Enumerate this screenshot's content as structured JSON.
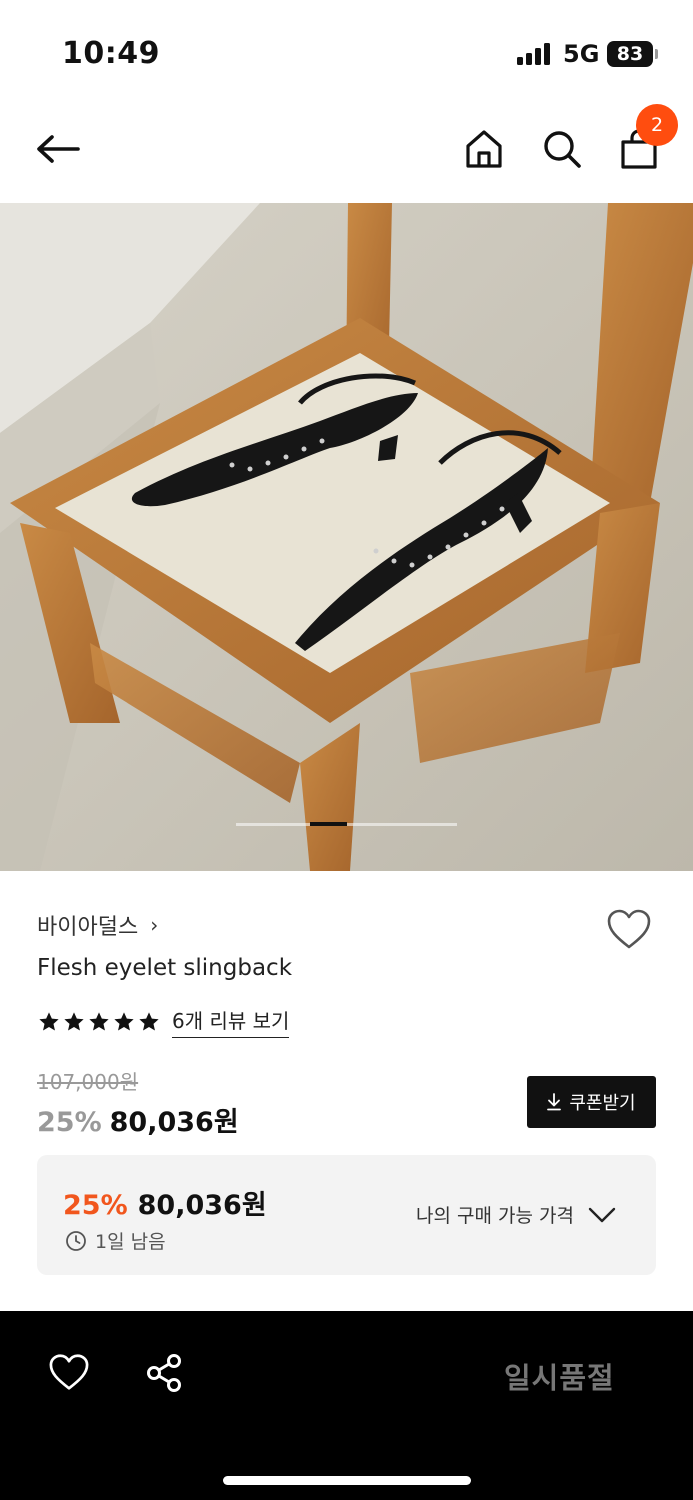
{
  "status_bar": {
    "time": "10:49",
    "network": "5G",
    "battery": "83"
  },
  "nav": {
    "back_icon": "arrow-left-icon",
    "home_icon": "home-icon",
    "search_icon": "search-icon",
    "cart_icon": "shopping-bag-icon",
    "cart_count": "2"
  },
  "carousel": {
    "total_slides": 6,
    "active_slide": 2
  },
  "product": {
    "brand": "바이아덜스",
    "brand_chevron": "›",
    "name": "Flesh eyelet slingback",
    "rating_stars": 5,
    "review_link": "6개 리뷰 보기",
    "original_price": "107,000원",
    "discount_rate": "25%",
    "sale_price": "80,036원",
    "coupon_button": "쿠폰받기"
  },
  "my_price": {
    "discount_rate": "25%",
    "price": "80,036원",
    "time_left": "1일 남음",
    "toggle_label": "나의 구매 가능 가격"
  },
  "bottom_bar": {
    "status_label": "일시품절"
  },
  "colors": {
    "accent": "#f1561d",
    "badge": "#ff4d0f",
    "dark": "#111111"
  }
}
